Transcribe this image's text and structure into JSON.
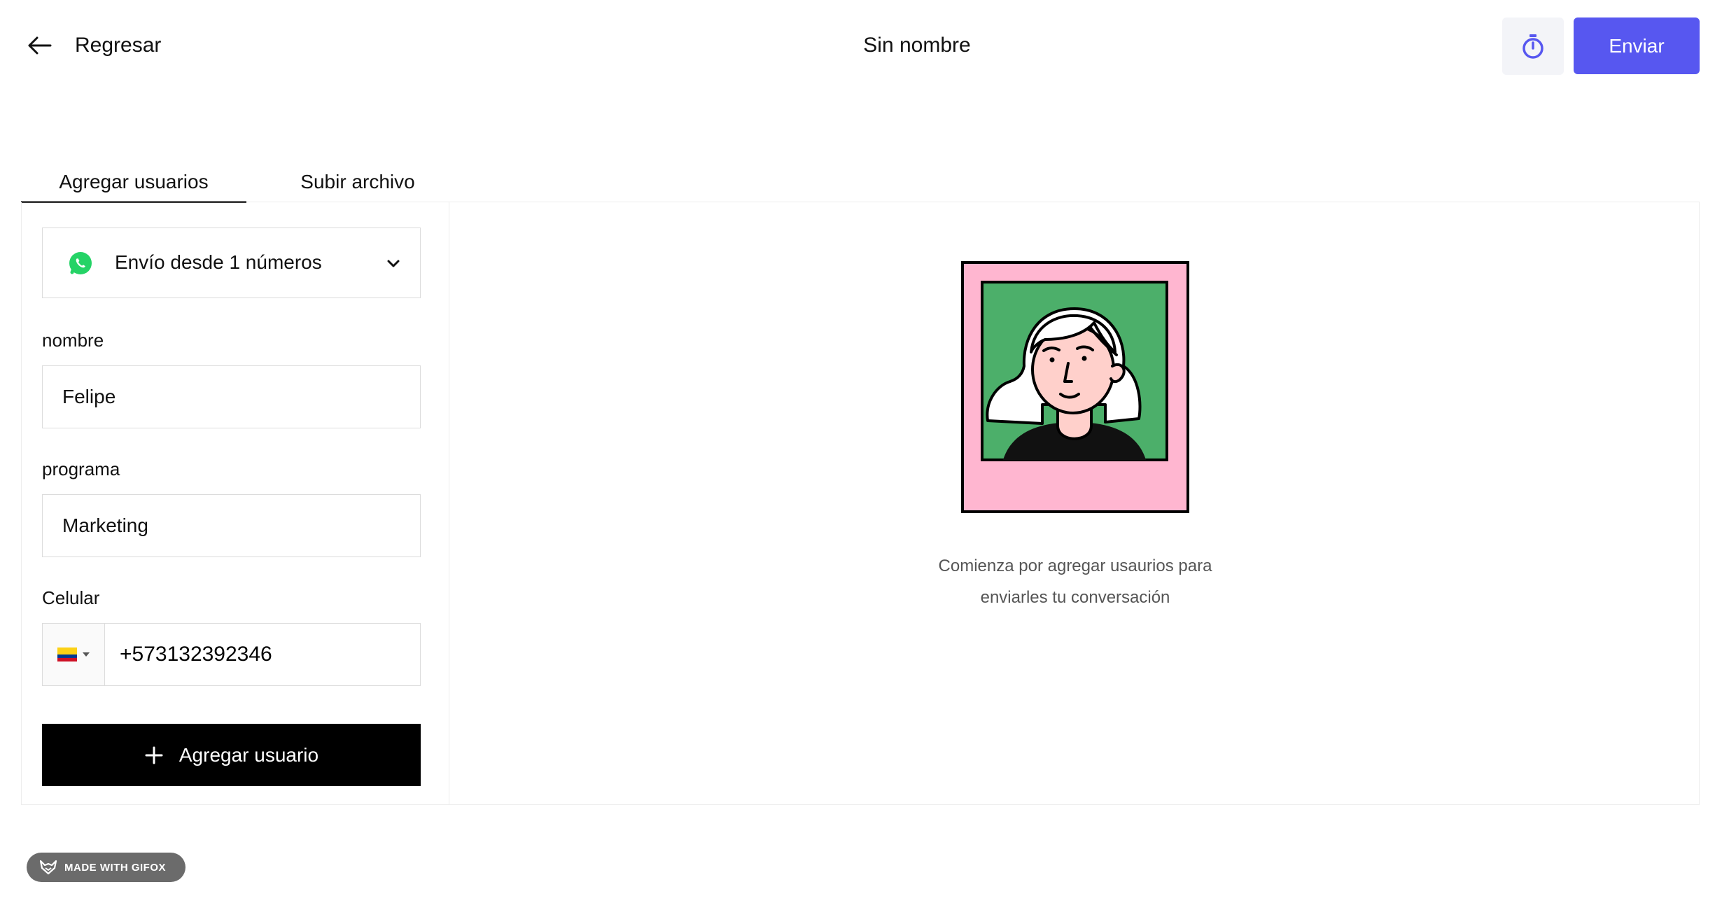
{
  "header": {
    "back_label": "Regresar",
    "title": "Sin nombre",
    "send_label": "Enviar"
  },
  "tabs": [
    {
      "label": "Agregar usuarios",
      "active": true
    },
    {
      "label": "Subir archivo",
      "active": false
    }
  ],
  "form": {
    "sender_select": {
      "value": "Envío desde 1 números",
      "icon": "whatsapp-icon"
    },
    "fields": [
      {
        "label": "nombre",
        "value": "Felipe"
      },
      {
        "label": "programa",
        "value": "Marketing"
      }
    ],
    "phone": {
      "label": "Celular",
      "country": "Colombia",
      "value": "+573132392346"
    },
    "add_user_label": "Agregar usuario"
  },
  "empty_state": {
    "line1": "Comienza por agregar usaurios para",
    "line2": "enviarles tu conversación"
  },
  "watermark": {
    "text": "MADE WITH GIFOX"
  },
  "colors": {
    "accent": "#5757f0",
    "button_dark": "#000000",
    "whatsapp": "#25d366",
    "illustration_pink": "#ffb6d0",
    "illustration_green": "#4caf6a"
  }
}
